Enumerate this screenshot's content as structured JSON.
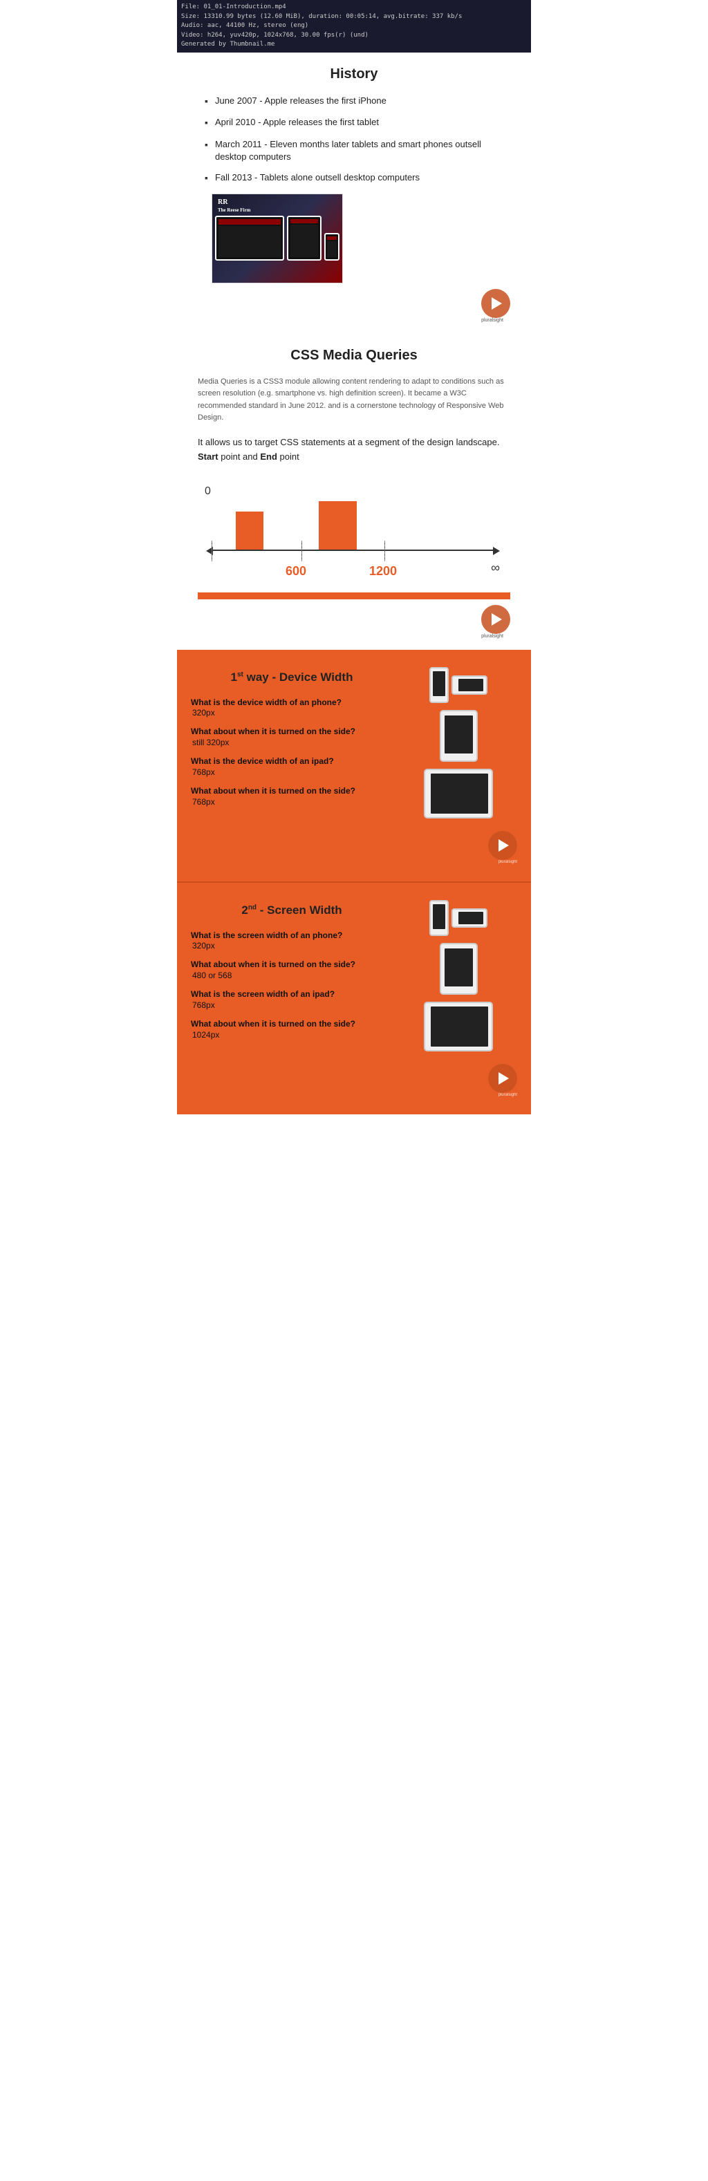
{
  "fileInfo": {
    "line1": "File: 01_01-Introduction.mp4",
    "line2": "Size: 13310.99 bytes (12.60 MiB), duration: 00:05:14, avg.bitrate: 337 kb/s",
    "line3": "Audio: aac, 44100 Hz, stereo (eng)",
    "line4": "Video: h264, yuv420p, 1024x768, 30.00 fps(r) (und)",
    "line5": "Generated by Thumbnail.me"
  },
  "history": {
    "title": "History",
    "bullets": [
      "June 2007 - Apple releases the first iPhone",
      "April 2010 - Apple releases the first tablet",
      "March 2011 - Eleven months later tablets and smart phones outsell desktop computers",
      "Fall 2013 - Tablets alone outsell desktop computers"
    ]
  },
  "cssMediaQueries": {
    "title": "CSS Media Queries",
    "description": "Media Queries is a CSS3 module allowing content rendering to adapt to conditions such as screen resolution (e.g. smartphone vs. high definition screen). It became a W3C recommended standard in June 2012. and is a cornerstone technology of Responsive Web Design.",
    "targetText1": "It allows us to target CSS statements at a segment of the design landscape.",
    "targetText2": "Start",
    "targetText3": " point and ",
    "targetText4": "End",
    "targetText5": " point",
    "diagram": {
      "label0": "0",
      "label600": "600",
      "label1200": "1200",
      "labelInf": "∞"
    }
  },
  "deviceWidth": {
    "title1": "1",
    "titleSup": "st",
    "title2": " way - Device Width",
    "qa": [
      {
        "question": "What is the device width of an phone?",
        "answer": "320px"
      },
      {
        "question": "What about when it is turned on the side?",
        "answer": "still 320px"
      },
      {
        "question": "What is the device width of an ipad?",
        "answer": "768px"
      },
      {
        "question": "What about when it is turned on the side?",
        "answer": "768px"
      }
    ]
  },
  "screenWidth": {
    "title1": "2",
    "titleSup": "nd",
    "title2": " - Screen Width",
    "qa": [
      {
        "question": "What is the screen width of an phone?",
        "answer": "320px"
      },
      {
        "question": "What about when it is turned on the side?",
        "answer": "480 or 568"
      },
      {
        "question": "What is the screen width of an ipad?",
        "answer": "768px"
      },
      {
        "question": "What about when it is turned on the side?",
        "answer": "1024px"
      }
    ]
  },
  "pluralsight": "pluralsight",
  "icons": {
    "play": "▶"
  }
}
